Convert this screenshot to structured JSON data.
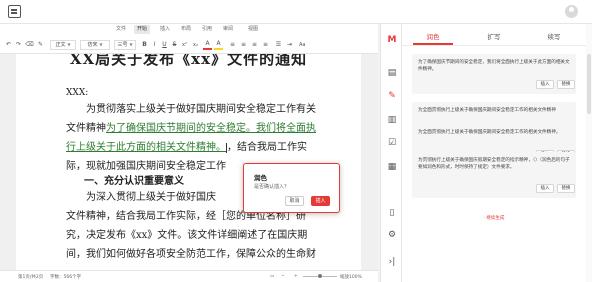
{
  "menu": {
    "items": [
      "文件",
      "开始",
      "插入",
      "布局",
      "引用",
      "审阅",
      "视图"
    ],
    "active_index": 1
  },
  "toolbar": {
    "undo": "↶",
    "redo": "↷",
    "clear_format": "⌫",
    "paint": "✎",
    "style_value": "正文",
    "font_value": "仿宋",
    "size_value": "三号",
    "bold": "B",
    "italic": "I",
    "underline": "U",
    "strike": "S",
    "superscript": "x²",
    "subscript": "x₂",
    "font_color": "A",
    "highlight": "A",
    "align_left": "≡",
    "align_center": "≡",
    "align_right": "≡",
    "justify": "≡",
    "list": "☰",
    "indent": "⇥",
    "case": "Aa"
  },
  "document": {
    "title": "XX局关于发布《xx》文件的通知",
    "greeting": "XXX:",
    "paragraph1": {
      "l1": "为贯彻落实上级关于做好国庆期间安全稳定工作有关",
      "l2_a": "文件精神",
      "l2_b": "为了确保国庆节期间的安全稳定。我们将全面执",
      "l3_a": "行上级关于此方面的相关文件精神。",
      "l3_b": "，结合我局工作实",
      "l4": "际，现就加强国庆期间安全稳定工作"
    },
    "section_title": "一、充分认识重要意义",
    "paragraph2": {
      "l1": "为深入贯彻上级关于做好国庆",
      "l2": "文件精神，结合我局工作实际，经［您的单位名称］研",
      "l3": "究，决定发布《xx》文件。该文件详细阐述了在国庆期",
      "l4": "间，我们如何做好各项安全防范工作，保障公众的生命财"
    }
  },
  "status": {
    "page": "第1页/共2页",
    "words": "字数：566个字",
    "zoom": "缩放100%"
  },
  "dialog": {
    "title": "润色",
    "message": "是否确认插入？",
    "cancel": "取消",
    "confirm": "插入"
  },
  "panel": {
    "tabs": [
      "润色",
      "扩写",
      "续写"
    ],
    "active_tab": 0,
    "cards": [
      {
        "text": "为了确保国庆节期间的安全稳定，我们将全面执行上级关于此方面的相关文件精神。",
        "insert": "插入",
        "replace": "替换"
      },
      {
        "text": "为全面贯彻执行上级关于确保国庆期间安全稳定工作的相关文件精神",
        "insert": "插入",
        "replace": "替换"
      },
      {
        "text": "为全面贯彻执行上级关于确保国庆期间安全稳定工作的相关文件精神。",
        "insert": "插入",
        "replace": "替换"
      },
      {
        "text": "为贯彻执行上级关于确保国庆假期安全稳定的指示精神，（）（润色后的句子要如润色和形式，时时保持了规定）文件要求。",
        "insert": "插入",
        "replace": "替换"
      }
    ],
    "more": "· 继续生成"
  },
  "colors": {
    "accent": "#e53935",
    "green_insert": "#2e7d32"
  }
}
